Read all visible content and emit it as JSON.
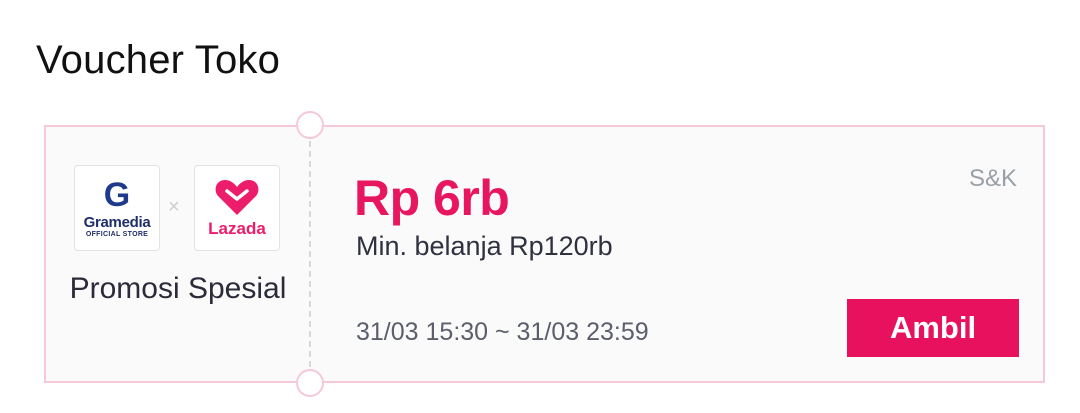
{
  "section": {
    "title": "Voucher Toko"
  },
  "voucher": {
    "brands": {
      "gramedia": {
        "letter": "G",
        "name": "Gramedia",
        "subtitle": "OFFICIAL STORE"
      },
      "separator": "×",
      "lazada": {
        "name": "Lazada"
      }
    },
    "promo_label": "Promosi Spesial",
    "amount": "Rp 6rb",
    "terms": "S&K",
    "min_spend": "Min. belanja Rp120rb",
    "validity": "31/03 15:30 ~ 31/03 23:59",
    "claim_label": "Ambil"
  },
  "colors": {
    "accent": "#e8115d",
    "border": "#f6c9d6",
    "gramedia_blue": "#1f3a8a",
    "lazada_pink": "#ec1d6b"
  },
  "icons": [
    "gramedia-logo-icon",
    "times-icon",
    "lazada-heart-icon"
  ]
}
